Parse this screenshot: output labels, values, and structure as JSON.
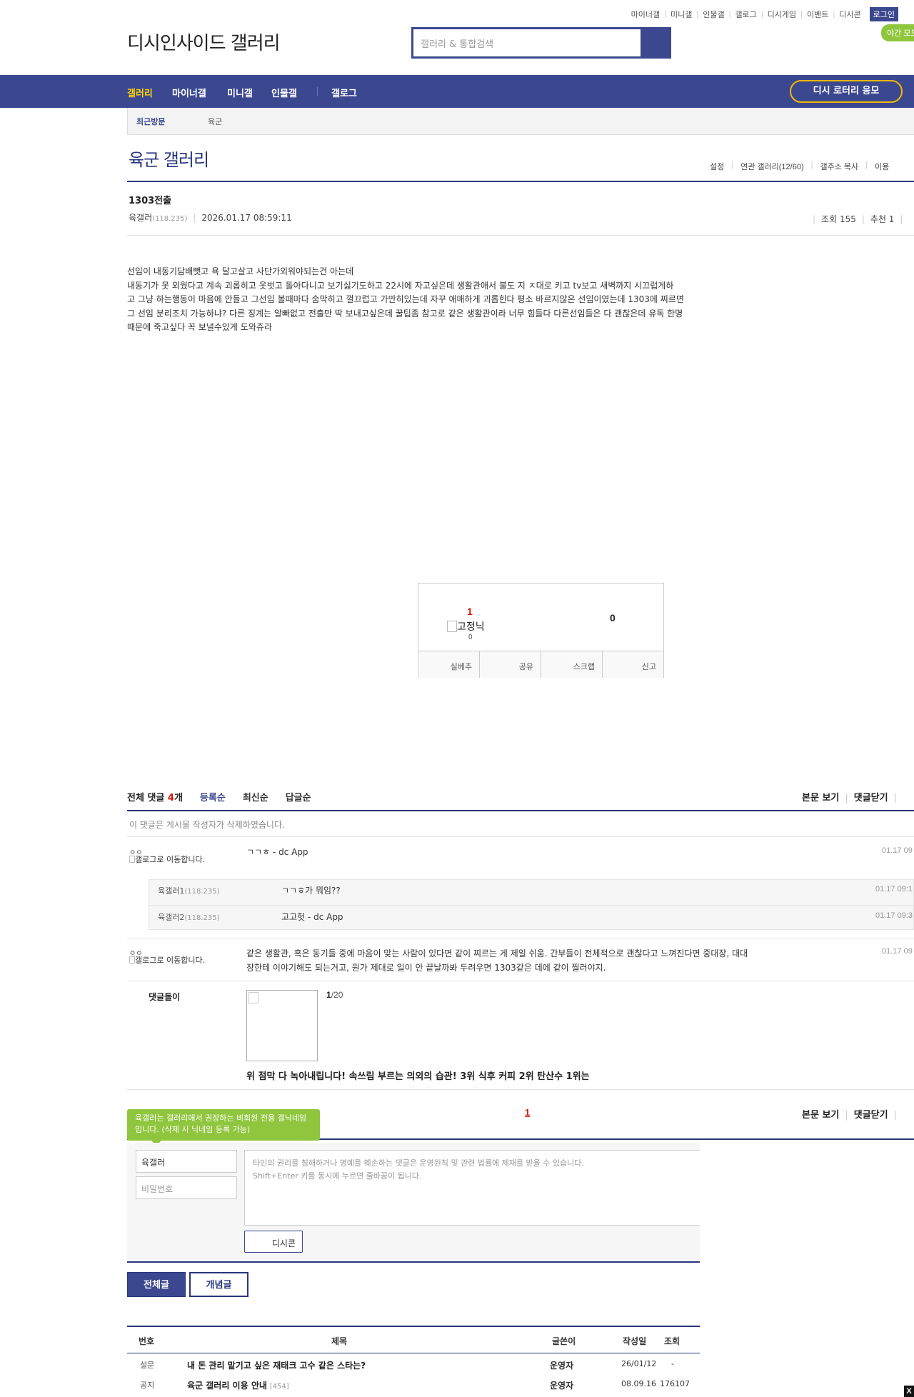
{
  "toplinks": [
    "마이너갤",
    "미니갤",
    "인물갤",
    "갤로그",
    "디시게임",
    "이벤트",
    "디시콘"
  ],
  "login": "로그인",
  "night": "야간 모드",
  "logo": "디시인사이드 갤러리",
  "search": {
    "placeholder": "갤러리 & 통합검색"
  },
  "gnb": {
    "items": [
      "갤러리",
      "마이너갤",
      "미니갤",
      "인물갤",
      "갤로그"
    ],
    "lotto": "디시 로터리 응모"
  },
  "visit": {
    "label": "최근방문",
    "item": "육군"
  },
  "gallery": {
    "title": "육군 갤러리",
    "tools": [
      "설정",
      "연관 갤러리(12/60)",
      "갤주소 복사",
      "이용"
    ]
  },
  "post": {
    "title": "1303전출",
    "author": "육갤러",
    "ip": "(118.235)",
    "datetime": "2026.01.17 08:59:11",
    "views": "조회 155",
    "recs": "추천 1",
    "lines": [
      "선임이 내동기담배뺏고 욕 달고살고 사단가외워야되는건 아는데",
      "내동기가 못 외웠다고 계속 괴롭히고 옷벗고 돌아다니고 보기싫기도하고 22시에 자고싶은데 생활관애서 불도 지 ㅈ대로 키고 tv보고 새벽까지 시끄럽게하",
      "고 그냥 하는행동이 마음에 안들고 그선임 볼때마다 숨막히고 껄끄럽고 가만히있는데 자꾸 애매하게 괴롭힌다 평소 바르지않은 선임이였는데 1303에 찌르면",
      "그 선임 분리조치 가능하냐? 다른 징계는 알빠없고 전출만 딱 보내고싶은데 꿀팁좀 참고로 같은 생활관이라 너무 힘들다 다른선임들은 다 괜찮은데 유독 한명",
      "때문에 죽고싶다 꼭 보낼수있게 도와쥬라"
    ]
  },
  "recommend": {
    "up": "1",
    "fixed": "고정닉",
    "fixed_count": "0",
    "down": "0",
    "buttons": [
      "실베추",
      "공유",
      "스크랩",
      "신고"
    ]
  },
  "comments": {
    "total_label": "전체 댓글 ",
    "total": "4",
    "unit": "개",
    "sorts": [
      "등록순",
      "최신순",
      "답글순"
    ],
    "right": [
      "본문 보기",
      "댓글닫기"
    ],
    "deleted": "이 댓글은 게시물 작성자가 삭제하였습니다.",
    "items": [
      {
        "nick": "ㅇㅇ",
        "avatar": "갤로그로 이동합니다.",
        "text": "ㄱㄱㅎ - dc App",
        "date": "01.17 09"
      },
      {
        "nick": "ㅇㅇ",
        "avatar": "갤로그로 이동합니다.",
        "text": "같은 생활관, 혹은 동기들 중에 마음이 맞는 사람이 있다면 같이 찌르는 게 제일 쉬움. 간부들이 전체적으로 괜찮다고 느껴진다면 중대장, 대대",
        "text2": "장한테 이야기해도 되는거고, 뭔가 제대로 일이 안 끝날까봐 두려우면 1303같은 데에 같이 찔러야지.",
        "date": "01.17 09"
      }
    ],
    "replies": [
      {
        "nick": "육갤러1",
        "ip": "(118.235)",
        "text": "ㄱㄱㅎ가 뭐임??",
        "date": "01.17 09:1"
      },
      {
        "nick": "육갤러2",
        "ip": "(118.235)",
        "text": "고고헛 - dc App",
        "date": "01.17 09:3"
      }
    ],
    "dol": {
      "label": "댓글돌이",
      "page": "1",
      "total": "/20",
      "headline": "위 점막 다 녹아내립니다! 속쓰림 부르는 의외의 습관! 3위 식후 커피 2위 탄산수 1위는"
    },
    "page": "1"
  },
  "write": {
    "tip": "육갤러는 갤러리에서 권장하는 비회원 전용 갤닉네임입니다. (삭제 시 닉네임 등록 가능)",
    "nick": "육갤러",
    "pw_placeholder": "비밀번호",
    "notice1": "타인의 권리를 침해하거나 명예를 훼손하는 댓글은 운영원칙 및 관련 법률에 제재를 받을 수 있습니다.",
    "notice2": "Shift+Enter 키를 동시에 누르면 줄바꿈이 됩니다.",
    "dccon": "디시콘"
  },
  "tabs": {
    "all": "전체글",
    "best": "개념글"
  },
  "list": {
    "headers": [
      "번호",
      "제목",
      "글쓴이",
      "작성일",
      "조회"
    ],
    "rows": [
      {
        "no": "설문",
        "title": "내 돈 관리 맡기고 싶은 재태크 고수 같은 스타는?",
        "reply": "",
        "writer": "운영자",
        "date": "26/01/12",
        "views": "-"
      },
      {
        "no": "공지",
        "title": "육군 갤러리 이용 안내",
        "reply": "[454]",
        "writer": "운영자",
        "date": "08.09.16",
        "views": "176107"
      }
    ]
  },
  "colors": {
    "brand": "#3b4890",
    "accent": "#d31900",
    "green": "#8fc63d",
    "lotto": "#f5b800"
  }
}
